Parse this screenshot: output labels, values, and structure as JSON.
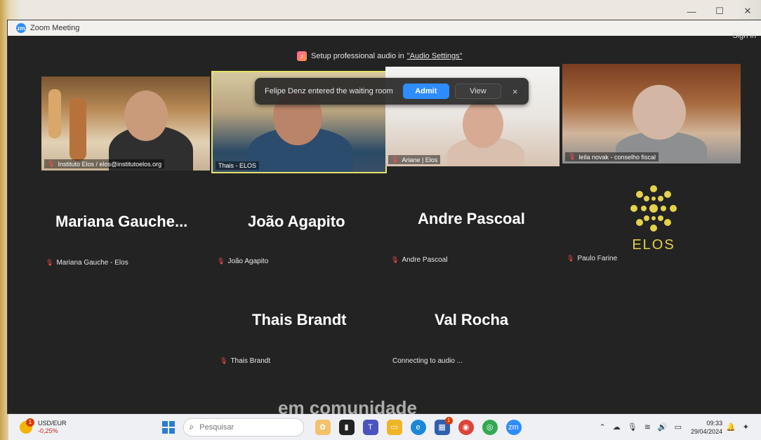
{
  "window": {
    "title": "Zoom Meeting",
    "app_icon": "zoom-icon",
    "sign_in": "Sign in",
    "controls": {
      "minimize": "—",
      "maximize": "☐",
      "close": "✕"
    }
  },
  "audio_banner": {
    "text": "Setup professional audio in",
    "link": "\"Audio Settings\""
  },
  "notification": {
    "message": "Felipe Denz entered the waiting room",
    "admit": "Admit",
    "view": "View",
    "close": "×"
  },
  "video_tiles": [
    {
      "name": "Instituto Elos / elos@institutoelos.org"
    },
    {
      "name": "Thais - ELOS"
    },
    {
      "name": "Ariane | Elos"
    },
    {
      "name": "leila novak - conselho fiscal"
    }
  ],
  "name_tiles": [
    {
      "display": "Mariana  Gauche...",
      "tag": "Mariana Gauche - Elos"
    },
    {
      "display": "João Agapito",
      "tag": "João Agapito"
    },
    {
      "display": "Andre Pascoal",
      "tag": "Andre Pascoal"
    },
    {
      "display": "",
      "tag": "Paulo Farine",
      "logo_text": "ELOS"
    },
    {
      "display": "Thais Brandt",
      "tag": "Thais Brandt"
    },
    {
      "display": "Val Rocha",
      "tag": "Connecting to audio ..."
    }
  ],
  "background_text": "em comunidade",
  "taskbar": {
    "weather_badge": "1",
    "ticker_name": "USD/EUR",
    "ticker_change": "-0,25%",
    "search_placeholder": "Pesquisar",
    "store_badge": "1",
    "time": "09:33",
    "date": "29/04/2024"
  },
  "colors": {
    "accent": "#2d8cff",
    "active_speaker": "#e5e26a",
    "logo": "#e4d24c",
    "muted": "#ff4d4d"
  }
}
